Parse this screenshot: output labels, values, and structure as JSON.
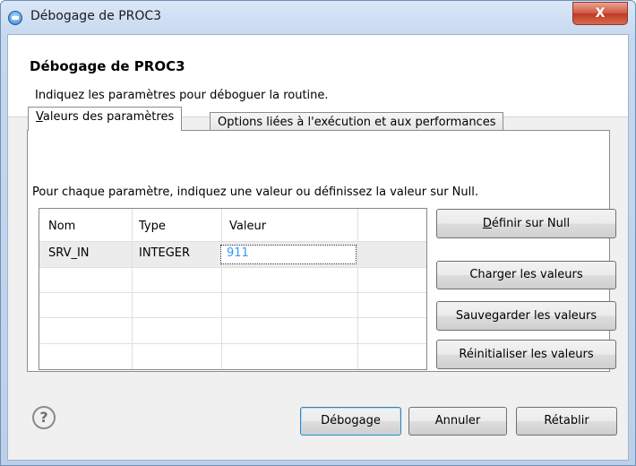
{
  "window": {
    "title": "Débogage de PROC3",
    "close_label": "X"
  },
  "header": {
    "title": "Débogage de PROC3",
    "description": "Indiquez les paramètres pour déboguer la routine."
  },
  "tabs": [
    {
      "mnemonic": "V",
      "rest": "aleurs des paramètres",
      "active": true
    },
    {
      "label": "Options liées à l'exécution et aux performances",
      "active": false
    }
  ],
  "instruction": "Pour chaque paramètre, indiquez une valeur ou définissez la valeur sur Null.",
  "table": {
    "columns": [
      "Nom",
      "Type",
      "Valeur"
    ],
    "rows": [
      {
        "nom": "SRV_IN",
        "type": "INTEGER",
        "valeur": "911"
      }
    ]
  },
  "side_buttons": {
    "set_null_mnemonic": "D",
    "set_null_rest": "éfinir sur Null",
    "load": "Charger les valeurs",
    "save": "Sauvegarder les valeurs",
    "reset": "Réinitialiser les valeurs"
  },
  "footer": {
    "help_icon": "?",
    "debug": "Débogage",
    "cancel": "Annuler",
    "restore": "Rétablir"
  },
  "colors": {
    "value_text": "#3399ff",
    "close_button": "#c94a32",
    "title_bar": "#c6d8ef"
  }
}
